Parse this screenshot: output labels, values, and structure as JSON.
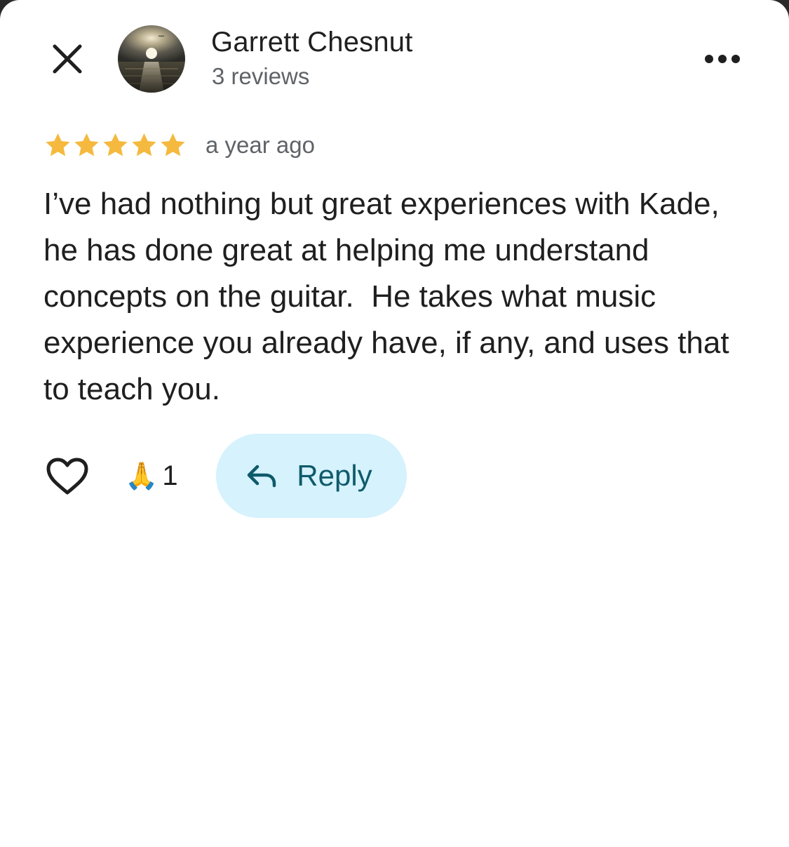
{
  "header": {
    "close_icon": "close-icon",
    "author_name": "Garrett Chesnut",
    "review_count": "3 reviews",
    "more_icon": "more-horizontal-icon"
  },
  "review": {
    "rating": 5,
    "rating_max": 5,
    "star_color": "#f4b93e",
    "date": "a year ago",
    "text": "I’ve had nothing but great experiences with Kade, he has done great at helping me understand concepts on the guitar.  He takes what music experience you already have, if any, and uses that to teach you."
  },
  "actions": {
    "like_icon": "heart-outline-icon",
    "reaction_emoji": "🙏",
    "reaction_count": "1",
    "reply_icon": "reply-arrow-icon",
    "reply_label": "Reply",
    "reply_bg": "#d5f2fd",
    "reply_color": "#0f5a6a"
  }
}
